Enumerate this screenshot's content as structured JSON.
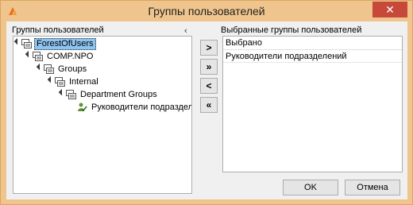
{
  "window": {
    "title": "Группы пользователей",
    "close_glyph": "✕",
    "accent_color": "#f0c58d",
    "close_color": "#c7493a"
  },
  "left_panel": {
    "label": "Группы пользователей",
    "collapse_glyph": "‹"
  },
  "tree": [
    {
      "label": "ForestOfUsers",
      "icon": "group-icon",
      "selected": true
    },
    {
      "label": "COMP.NPO",
      "icon": "group-icon"
    },
    {
      "label": "Groups",
      "icon": "group-icon"
    },
    {
      "label": "Internal",
      "icon": "group-icon"
    },
    {
      "label": "Department Groups",
      "icon": "group-icon"
    },
    {
      "label": "Руководители подразделений",
      "icon": "user-group-check-icon"
    }
  ],
  "transfer_buttons": {
    "add": ">",
    "add_all": "»",
    "remove": "<",
    "remove_all": "«"
  },
  "right_panel": {
    "label": "Выбранные группы пользователей",
    "header": "Выбрано",
    "items": [
      "Руководители подразделений"
    ]
  },
  "buttons": {
    "ok": "OK",
    "cancel": "Отмена"
  }
}
